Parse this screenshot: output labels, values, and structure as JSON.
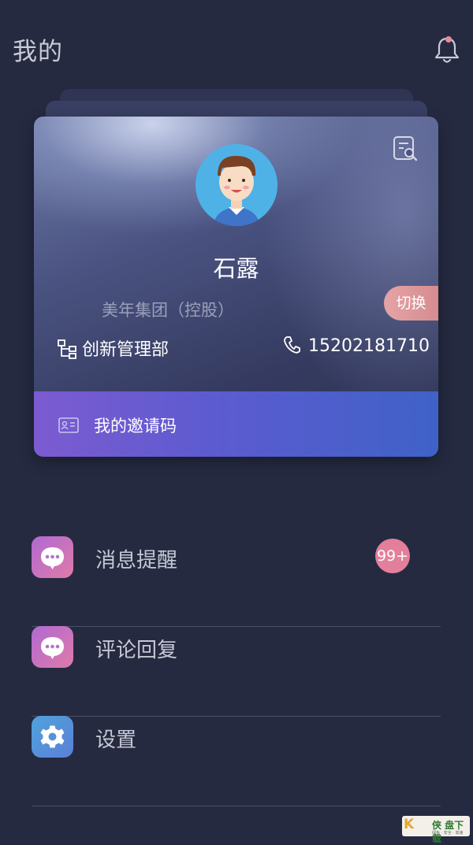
{
  "header": {
    "title": "我的"
  },
  "card": {
    "name": "石露",
    "company": "美年集团（控股）",
    "switch_label": "切换",
    "department": "创新管理部",
    "phone": "15202181710",
    "invite_label": "我的邀请码"
  },
  "menu": [
    {
      "label": "消息提醒",
      "icon": "chat-bubble-icon",
      "badge": "99+"
    },
    {
      "label": "评论回复",
      "icon": "chat-bubble-icon"
    },
    {
      "label": "设置",
      "icon": "gear-icon"
    }
  ],
  "watermark": {
    "logo": "K",
    "text": "侠 盘下载",
    "subtitle": "绿色 · 安全 · 高速"
  },
  "colors": {
    "background": "#252a41",
    "invite_gradient_start": "#7c5bd1",
    "invite_gradient_end": "#3f62c7",
    "badge": "#e37f9a",
    "switch": "#e5a4a6",
    "notification_dot": "#e88a9a"
  }
}
